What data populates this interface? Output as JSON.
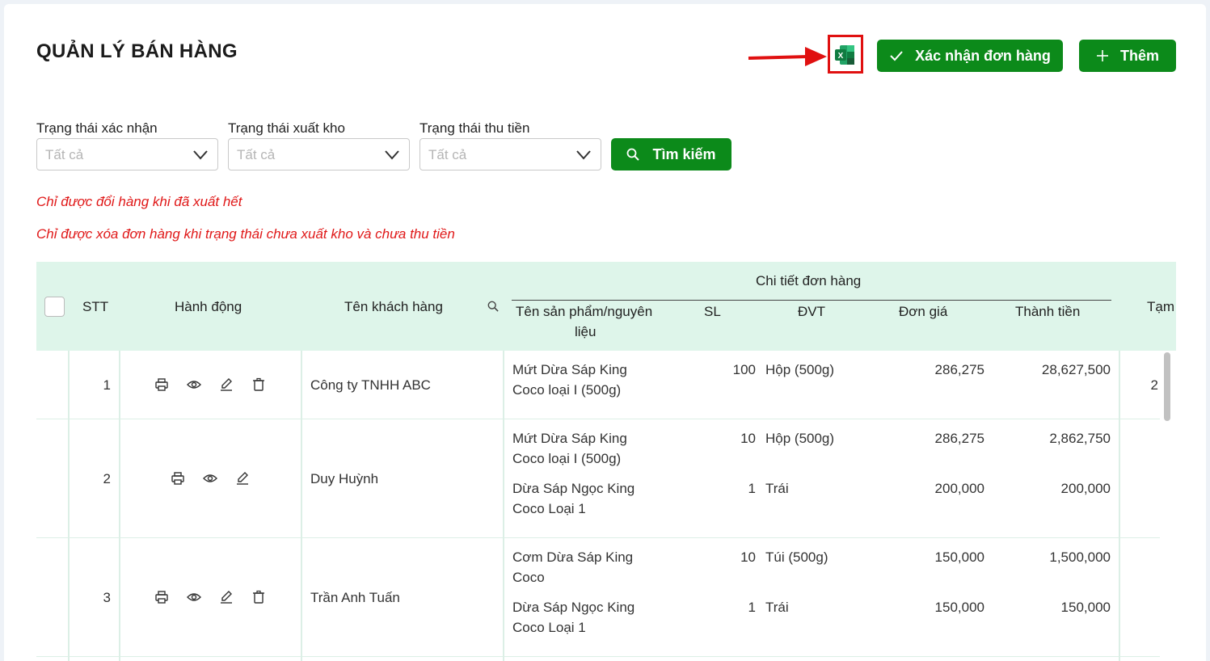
{
  "page": {
    "title": "QUẢN LÝ BÁN HÀNG"
  },
  "toolbar": {
    "excel_icon": "excel-icon",
    "confirm_label": "Xác nhận đơn hàng",
    "add_label": "Thêm"
  },
  "filters": {
    "confirm_status": {
      "label": "Trạng thái xác nhận",
      "placeholder": "Tất cả"
    },
    "export_status": {
      "label": "Trạng thái xuất kho",
      "placeholder": "Tất cả"
    },
    "payment_status": {
      "label": "Trạng thái thu tiền",
      "placeholder": "Tất cả"
    },
    "search_label": "Tìm kiếm"
  },
  "notes": {
    "note1": "Chỉ được đổi hàng khi đã xuất hết",
    "note2": "Chỉ được xóa đơn hàng khi trạng thái chưa xuất kho và chưa thu tiền"
  },
  "table": {
    "headers": {
      "stt": "STT",
      "actions": "Hành động",
      "customer": "Tên khách hàng",
      "order_details": "Chi tiết đơn hàng",
      "product_line1": "Tên sản phẩm/nguyên",
      "product_line2": "liệu",
      "qty": "SL",
      "unit": "ĐVT",
      "price": "Đơn giá",
      "total": "Thành tiền",
      "temp": "Tạm"
    },
    "rows": [
      {
        "stt": "1",
        "customer": "Công ty TNHH ABC",
        "items": [
          {
            "name1": "Mứt Dừa Sáp King",
            "name2": "Coco loại I (500g)",
            "qty": "100",
            "unit": "Hộp (500g)",
            "price": "286,275",
            "total": "28,627,500"
          }
        ],
        "temp": "2"
      },
      {
        "stt": "2",
        "customer": "Duy Huỳnh",
        "items": [
          {
            "name1": "Mứt Dừa Sáp King",
            "name2": "Coco loại I (500g)",
            "qty": "10",
            "unit": "Hộp (500g)",
            "price": "286,275",
            "total": "2,862,750"
          },
          {
            "name1": "Dừa Sáp Ngọc King",
            "name2": "Coco Loại 1",
            "qty": "1",
            "unit": "Trái",
            "price": "200,000",
            "total": "200,000"
          }
        ]
      },
      {
        "stt": "3",
        "customer": "Trần Anh Tuấn",
        "items": [
          {
            "name1": "Cơm Dừa Sáp King",
            "name2": "Coco",
            "qty": "10",
            "unit": "Túi (500g)",
            "price": "150,000",
            "total": "1,500,000"
          },
          {
            "name1": "Dừa Sáp Ngọc King",
            "name2": "Coco Loại 1",
            "qty": "1",
            "unit": "Trái",
            "price": "150,000",
            "total": "150,000"
          }
        ]
      }
    ]
  },
  "colors": {
    "primary": "#0c8a1a",
    "warning": "#e01818",
    "header_bg": "#def5ea"
  }
}
